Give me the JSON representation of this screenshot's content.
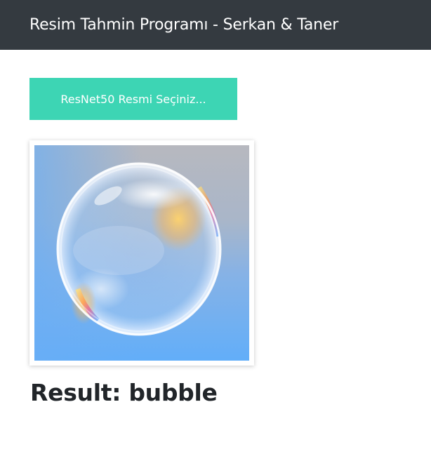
{
  "header": {
    "title": "Resim Tahmin Programı - Serkan & Taner"
  },
  "upload": {
    "button_label": "ResNet50 Resmi Seçiniz..."
  },
  "preview": {
    "icon": "bubble-photo",
    "background_colors": [
      "#b8b8bf",
      "#67b0fb"
    ]
  },
  "result": {
    "label": "Result: ",
    "value": "bubble"
  },
  "colors": {
    "navbar": "#343a40",
    "button": "#3dd5b4",
    "text": "#212529"
  }
}
